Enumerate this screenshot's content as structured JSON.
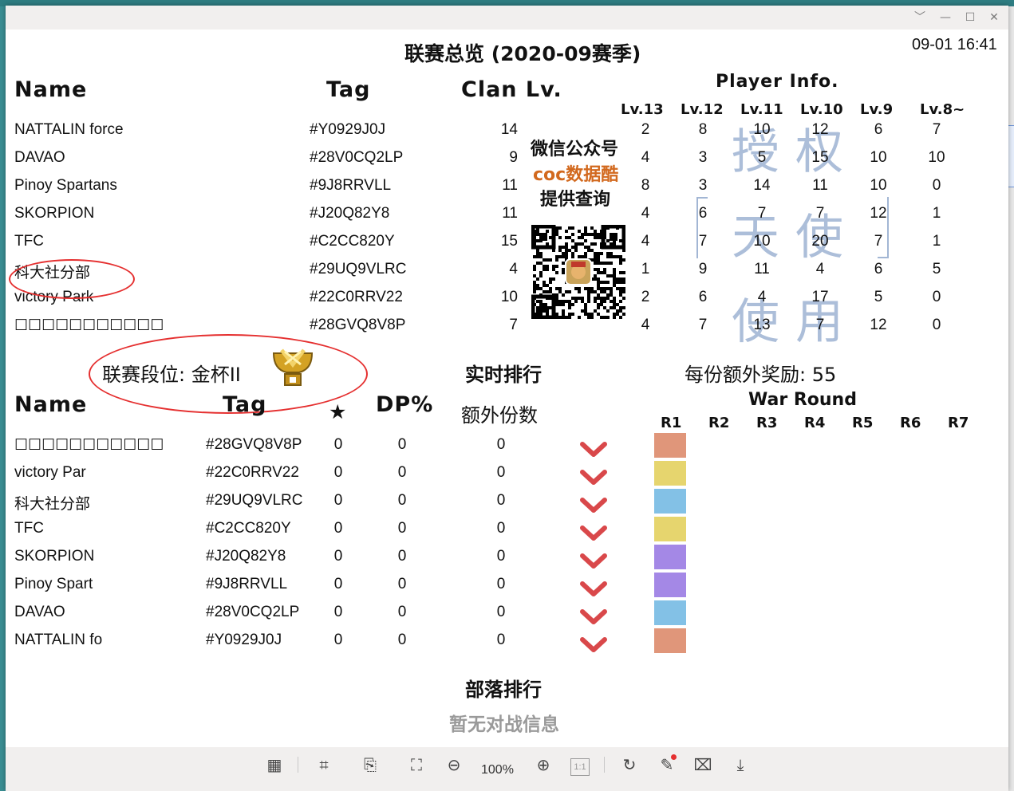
{
  "window": {
    "controls": [
      "﹀",
      "—",
      "☐",
      "✕"
    ]
  },
  "header": {
    "title": "联赛总览 (2020-09赛季)",
    "time": "09-01 16:41"
  },
  "clans": {
    "col_name": "Name",
    "col_tag": "Tag",
    "col_lv": "Clan Lv.",
    "player_info": "Player Info.",
    "lv_headers": [
      "Lv.13",
      "Lv.12",
      "Lv.11",
      "Lv.10",
      "Lv.9",
      "Lv.8~"
    ],
    "rows": [
      {
        "name": "NATTALIN force",
        "tag": "#Y0929J0J",
        "lv": "14",
        "p": [
          "2",
          "8",
          "10",
          "12",
          "6",
          "7"
        ]
      },
      {
        "name": "DAVAO",
        "tag": "#28V0CQ2LP",
        "lv": "9",
        "p": [
          "4",
          "3",
          "5",
          "15",
          "10",
          "10"
        ]
      },
      {
        "name": "Pinoy Spartans",
        "tag": "#9J8RRVLL",
        "lv": "11",
        "p": [
          "8",
          "3",
          "14",
          "11",
          "10",
          "0"
        ]
      },
      {
        "name": "SKORPION",
        "tag": "#J20Q82Y8",
        "lv": "11",
        "p": [
          "4",
          "6",
          "7",
          "7",
          "12",
          "1"
        ]
      },
      {
        "name": "TFC",
        "tag": "#C2CC820Y",
        "lv": "15",
        "p": [
          "4",
          "7",
          "10",
          "20",
          "7",
          "1"
        ]
      },
      {
        "name": "科大社分部",
        "tag": "#29UQ9VLRC",
        "lv": "4",
        "p": [
          "1",
          "9",
          "11",
          "4",
          "6",
          "5"
        ]
      },
      {
        "name": "victory Park",
        "tag": "#22C0RRV22",
        "lv": "10",
        "p": [
          "2",
          "6",
          "4",
          "17",
          "5",
          "0"
        ]
      },
      {
        "name": "☐☐☐☐☐☐☐☐☐☐☐",
        "tag": "#28GVQ8V8P",
        "lv": "7",
        "p": [
          "4",
          "7",
          "13",
          "7",
          "12",
          "0"
        ]
      }
    ]
  },
  "promo": {
    "line1": "微信公众号",
    "line2": "coc数据酷",
    "line3": "提供查询"
  },
  "watermark": {
    "c1": "授",
    "c2": "权",
    "c3": "天",
    "c4": "使",
    "c5": "使",
    "c6": "用"
  },
  "league": {
    "tier": "联赛段位: 金杯II",
    "realtime": "实时排行",
    "bonus": "每份额外奖励: 55",
    "col_name": "Name",
    "col_tag": "Tag",
    "col_star": "★",
    "col_dp": "DP%",
    "col_extra": "额外份数",
    "war_round": "War Round",
    "rounds": [
      "R1",
      "R2",
      "R3",
      "R4",
      "R5",
      "R6",
      "R7"
    ],
    "rows": [
      {
        "name": "☐☐☐☐☐☐☐☐☐☐☐",
        "tag": "#28GVQ8V8P",
        "star": "0",
        "dp": "0",
        "extra": "0",
        "color": "#e0967a"
      },
      {
        "name": "victory Par",
        "tag": "#22C0RRV22",
        "star": "0",
        "dp": "0",
        "extra": "0",
        "color": "#e6d56e"
      },
      {
        "name": "科大社分部",
        "tag": "#29UQ9VLRC",
        "star": "0",
        "dp": "0",
        "extra": "0",
        "color": "#83c1e6"
      },
      {
        "name": "TFC",
        "tag": "#C2CC820Y",
        "star": "0",
        "dp": "0",
        "extra": "0",
        "color": "#e6d56e"
      },
      {
        "name": "SKORPION",
        "tag": "#J20Q82Y8",
        "star": "0",
        "dp": "0",
        "extra": "0",
        "color": "#a488e6"
      },
      {
        "name": "Pinoy Spart",
        "tag": "#9J8RRVLL",
        "star": "0",
        "dp": "0",
        "extra": "0",
        "color": "#a488e6"
      },
      {
        "name": "DAVAO",
        "tag": "#28V0CQ2LP",
        "star": "0",
        "dp": "0",
        "extra": "0",
        "color": "#83c1e6"
      },
      {
        "name": "NATTALIN fo",
        "tag": "#Y0929J0J",
        "star": "0",
        "dp": "0",
        "extra": "0",
        "color": "#e0967a"
      }
    ]
  },
  "clan_rank": {
    "title": "部落排行",
    "empty": "暂无对战信息"
  },
  "toolbar": {
    "zoom": "100%",
    "one_to_one": "1:1"
  },
  "colors": {
    "accent_red": "#e53030",
    "chevron": "#d9484a",
    "promo_orange": "#d2691e"
  }
}
